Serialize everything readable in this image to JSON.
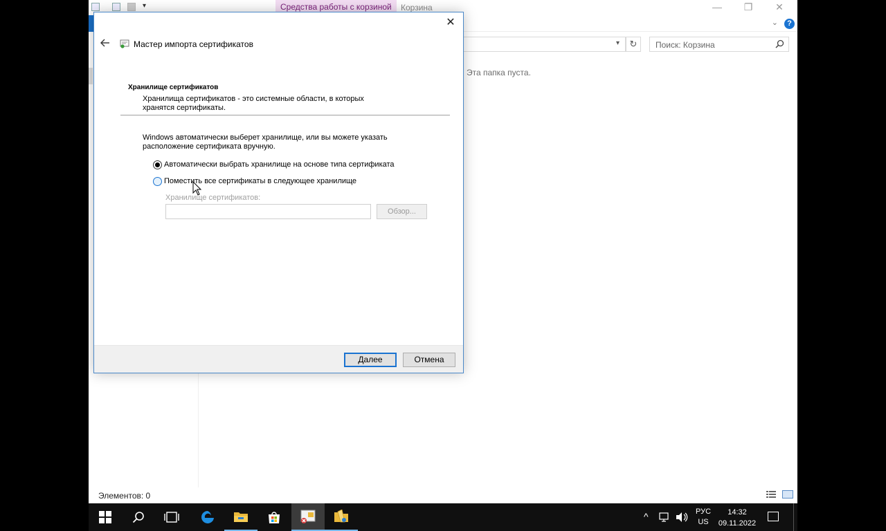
{
  "explorer": {
    "contextual_tab": "Средства работы с корзиной",
    "window_title": "Корзина",
    "search_placeholder": "Поиск: Корзина",
    "empty_message": "Эта папка пуста.",
    "status": "Элементов: 0",
    "minimize_glyph": "—",
    "restore_glyph": "❐",
    "close_glyph": "✕",
    "help_glyph": "?",
    "chevron_glyph": "⌄",
    "refresh_glyph": "↻",
    "dropdown_glyph": "▾"
  },
  "wizard": {
    "title": "Мастер импорта сертификатов",
    "close_glyph": "✕",
    "section_heading": "Хранилище сертификатов",
    "section_desc": "Хранилища сертификатов - это системные области, в которых хранятся сертификаты.",
    "intro": "Windows автоматически выберет хранилище, или вы можете указать расположение сертификата вручную.",
    "options": [
      {
        "label": "Автоматически выбрать хранилище на основе типа сертификата",
        "selected": true
      },
      {
        "label": "Поместить все сертификаты в следующее хранилище",
        "selected": false
      }
    ],
    "store_label": "Хранилище сертификатов:",
    "store_value": "",
    "browse_label": "Обзор...",
    "next_label": "Далее",
    "cancel_label": "Отмена"
  },
  "taskbar": {
    "items": [
      "start-icon",
      "search-icon",
      "task-view-icon",
      "edge-icon",
      "file-explorer-icon",
      "store-icon",
      "certificate-manager-icon",
      "folder-app-icon"
    ],
    "language_top": "РУС",
    "language_bottom": "US",
    "time": "14:32",
    "date": "09.11.2022",
    "tray_chevron": "^"
  },
  "colors": {
    "accent": "#1a73d1",
    "contextual_tab_bg": "#f3ddf3",
    "contextual_tab_fg": "#7a1f7a",
    "taskbar_bg": "#101010"
  }
}
